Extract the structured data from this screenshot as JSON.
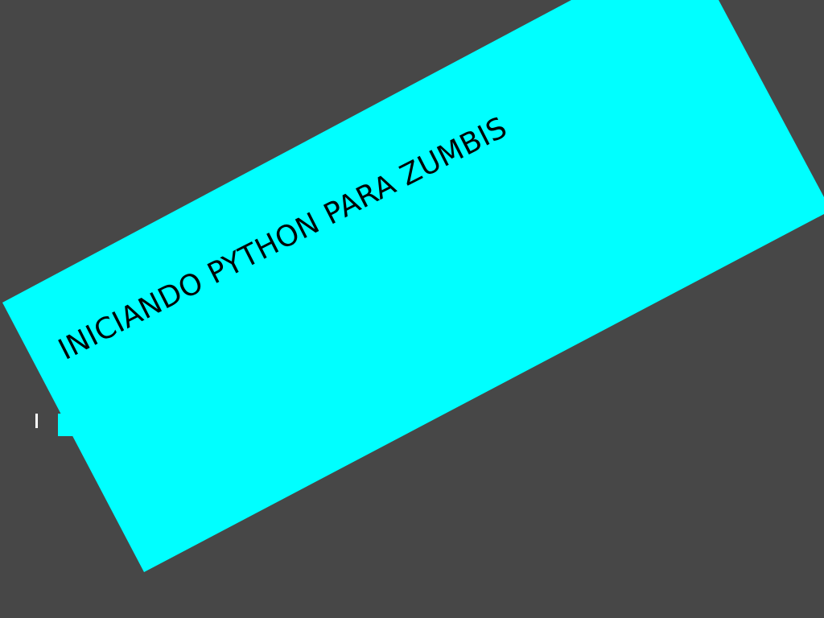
{
  "screen": {
    "title": "INICIANDO PYTHON PARA ZUMBIS"
  },
  "colors": {
    "background": "#474747",
    "banner": "#00FFFF",
    "text": "#000000",
    "marker": "#FFFFFF"
  },
  "icons": {
    "marker": "text-cursor-icon"
  }
}
